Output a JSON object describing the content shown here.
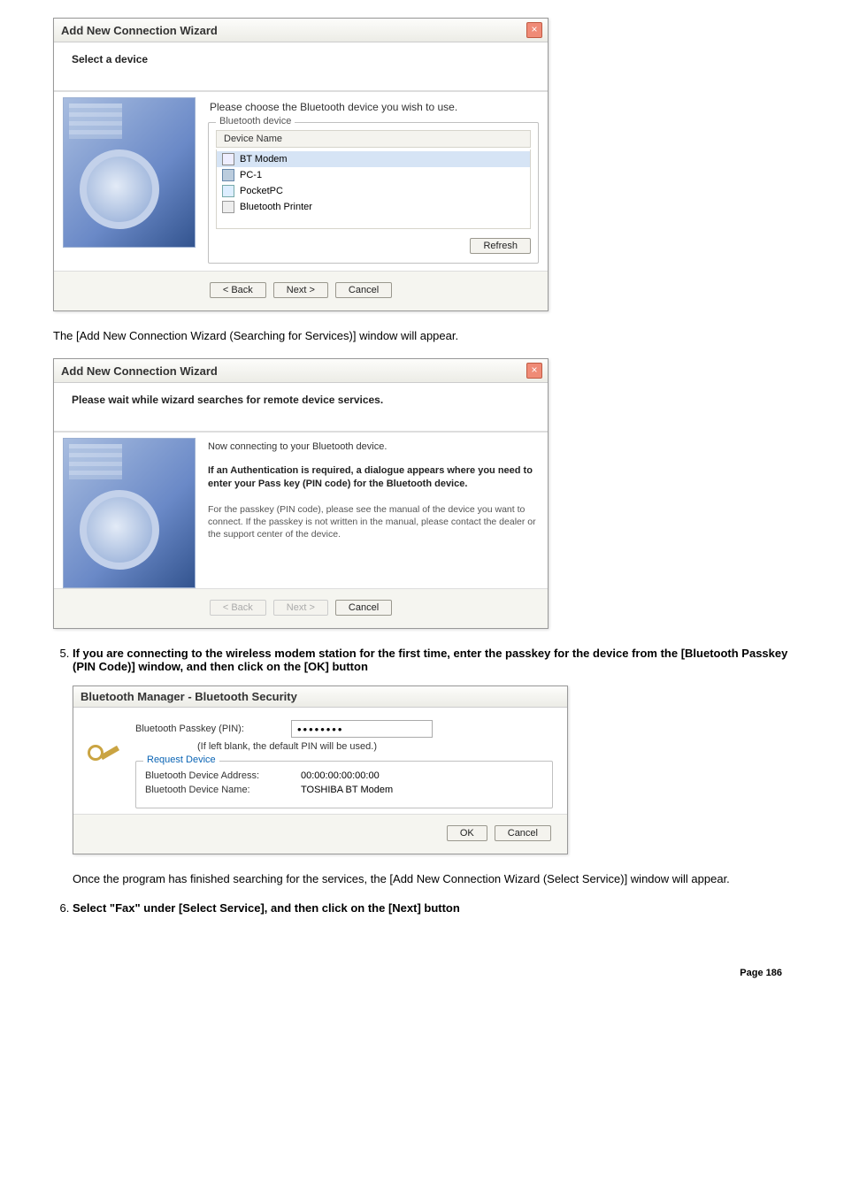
{
  "dialog1": {
    "title": "Add New Connection Wizard",
    "header": "Select a device",
    "prompt": "Please choose the Bluetooth device you wish to use.",
    "group_title": "Bluetooth device",
    "list_header": "Device Name",
    "devices": [
      "BT Modem",
      "PC-1",
      "PocketPC",
      "Bluetooth Printer"
    ],
    "refresh": "Refresh",
    "back": "< Back",
    "next": "Next >",
    "cancel": "Cancel"
  },
  "text_after_d1": "The [Add New Connection Wizard (Searching for Services)] window will appear.",
  "dialog2": {
    "title": "Add New Connection Wizard",
    "header": "Please wait while wizard searches for remote device services.",
    "msg1": "Now connecting to your Bluetooth device.",
    "msg2": "If an Authentication is required, a dialogue appears where you need to enter your Pass key (PIN code) for the Bluetooth device.",
    "msg3": "For the passkey (PIN code), please see the manual of the device you want to connect. If the passkey is not written in the manual, please contact the dealer or the support center of the device.",
    "back": "< Back",
    "next": "Next >",
    "cancel": "Cancel"
  },
  "step5": "If you are connecting to the wireless modem station for the first time, enter the passkey for the device from the [Bluetooth Passkey (PIN Code)] window, and then click on the [OK] button",
  "dialog3": {
    "title": "Bluetooth Manager - Bluetooth Security",
    "passkey_label": "Bluetooth Passkey (PIN):",
    "passkey_value": "••••••••",
    "hint": "(If left blank, the default PIN will be used.)",
    "request_title": "Request Device",
    "addr_label": "Bluetooth Device Address:",
    "addr_value": "00:00:00:00:00:00",
    "name_label": "Bluetooth Device Name:",
    "name_value": "TOSHIBA BT Modem",
    "ok": "OK",
    "cancel": "Cancel"
  },
  "text_after_d3": "Once the program has finished searching for the services, the [Add New Connection Wizard (Select Service)] window will appear.",
  "step6": "Select \"Fax\" under [Select Service], and then click on the [Next] button",
  "page_footer": "Page 186"
}
